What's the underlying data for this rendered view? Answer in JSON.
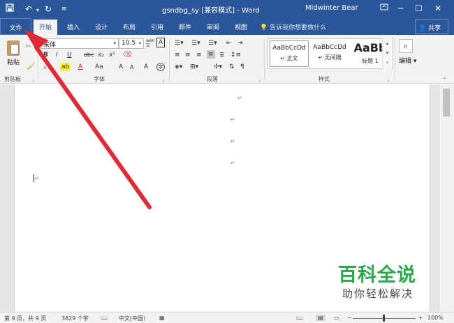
{
  "titlebar": {
    "save_icon": "save-icon",
    "undo_icon": "undo-icon",
    "redo_icon": "redo-icon",
    "customize_icon": "customize-icon",
    "document_title": "gsndbg_sy [兼容模式] - Word",
    "user_name": "Midwinter Bear",
    "ribbon_display_icon": "ribbon-display-icon",
    "minimize": "─",
    "maximize": "☐",
    "close": "✕"
  },
  "tabs": {
    "file": "文件",
    "home": "开始",
    "insert": "插入",
    "design": "设计",
    "layout": "布局",
    "references": "引用",
    "mailings": "邮件",
    "review": "审阅",
    "view": "视图",
    "tell_me": "告诉我你想要做什么",
    "share": "共享"
  },
  "ribbon": {
    "clipboard": {
      "paste_label": "粘贴",
      "group_label": "剪贴板"
    },
    "font": {
      "font_name": "宋体",
      "font_size": "10.5",
      "grow": "A",
      "shrink": "A",
      "bold": "B",
      "italic": "I",
      "underline": "U",
      "strike": "abc",
      "subscript": "x₂",
      "superscript": "x²",
      "highlight": "ab",
      "font_color": "A",
      "change_case": "Aa",
      "group_label": "字体"
    },
    "paragraph": {
      "group_label": "段落"
    },
    "styles": {
      "items": [
        {
          "preview": "AaBbCcDd",
          "name": "↵ 正文"
        },
        {
          "preview": "AaBbCcDd",
          "name": "↵ 无间隔"
        },
        {
          "preview": "AaBb",
          "name": "标题 1"
        }
      ],
      "group_label": "样式"
    },
    "editing": {
      "label": "编辑"
    }
  },
  "document": {
    "paragraph_mark": "↵"
  },
  "statusbar": {
    "page": "第 9 页，共 9 页",
    "words": "3829 个字",
    "language": "中文(中国)",
    "zoom_minus": "−",
    "zoom_plus": "+",
    "zoom_level": "100%",
    "zoom": 1.0
  },
  "watermark": {
    "title": "百科全说",
    "subtitle": "助你轻松解决"
  },
  "colors": {
    "title_bar": "#2b579a",
    "ribbon": "#f3f3f3",
    "arrow": "#e02a35",
    "watermark_green": "#2aa84a"
  }
}
